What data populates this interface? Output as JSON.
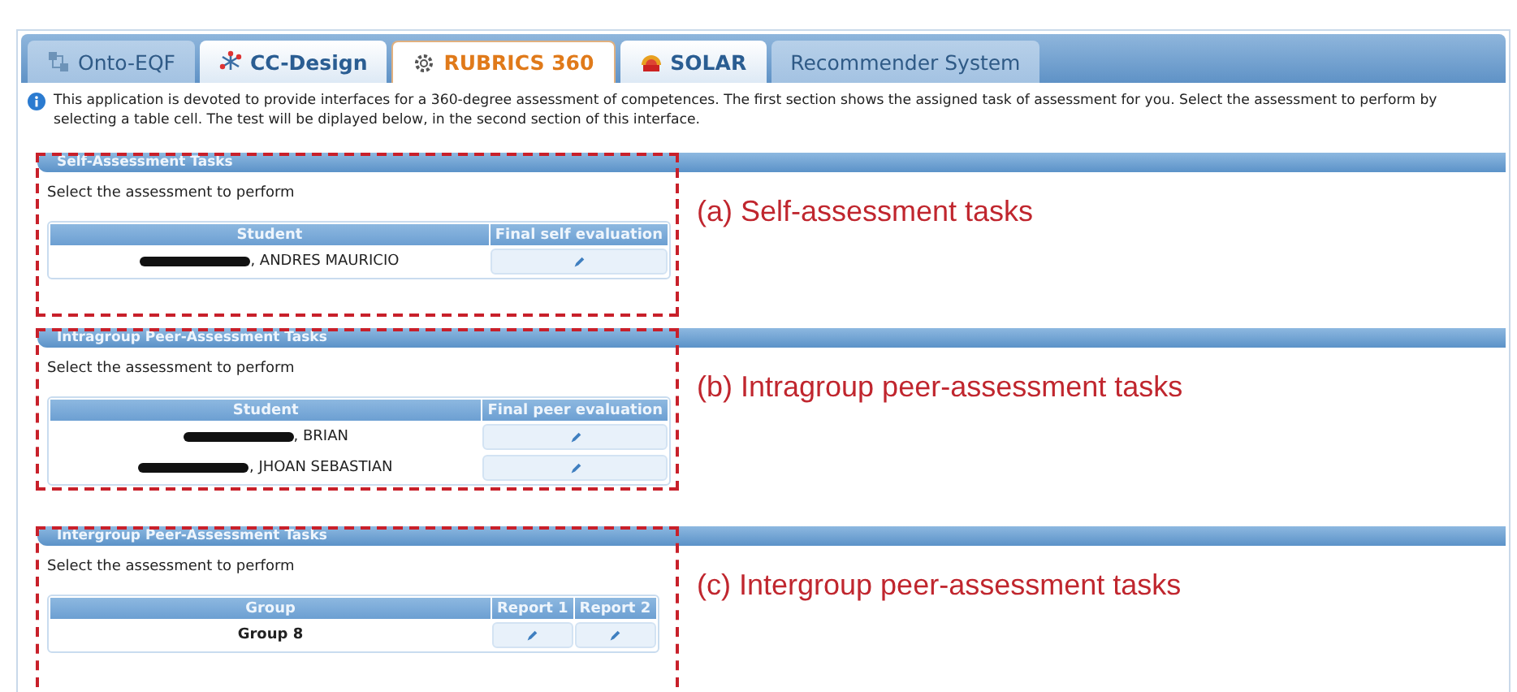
{
  "tabs": [
    {
      "label": "Onto-EQF",
      "kind": "onto",
      "selected": false,
      "disabled": true
    },
    {
      "label": "CC-Design",
      "kind": "ccdesign",
      "selected": false,
      "disabled": false
    },
    {
      "label": "RUBRICS 360",
      "kind": "gear",
      "selected": true,
      "disabled": false
    },
    {
      "label": "SOLAR",
      "kind": "solar",
      "selected": false,
      "disabled": false
    },
    {
      "label": "Recommender System",
      "kind": "none",
      "selected": false,
      "disabled": true
    }
  ],
  "info": "This application is devoted to provide interfaces for a 360-degree assessment of competences. The first section shows the assigned task of assessment for you. Select the assessment to perform by selecting a table cell. The test will be diplayed below, in the second section of this interface.",
  "sections": [
    {
      "title": "Self-Assessment Tasks",
      "prompt": "Select the assessment to perform",
      "annotation": "(a) Self-assessment tasks",
      "columns": [
        "Student",
        "Final self evaluation"
      ],
      "rows": [
        {
          "name": ", ANDRES MAURICIO",
          "redacted": true,
          "bold": false
        }
      ]
    },
    {
      "title": "Intragroup Peer-Assessment Tasks",
      "prompt": "Select the assessment to perform",
      "annotation": "(b) Intragroup peer-assessment tasks",
      "columns": [
        "Student",
        "Final peer evaluation"
      ],
      "rows": [
        {
          "name": ", BRIAN",
          "redacted": true,
          "bold": false
        },
        {
          "name": ", JHOAN SEBASTIAN",
          "redacted": true,
          "bold": false
        }
      ]
    },
    {
      "title": "Intergroup Peer-Assessment Tasks",
      "prompt": "Select the assessment to perform",
      "annotation": "(c) Intergroup peer-assessment tasks",
      "columns": [
        "Group",
        "Report 1",
        "Report 2"
      ],
      "rows": [
        {
          "name": "Group 8",
          "redacted": false,
          "bold": true
        }
      ]
    }
  ]
}
